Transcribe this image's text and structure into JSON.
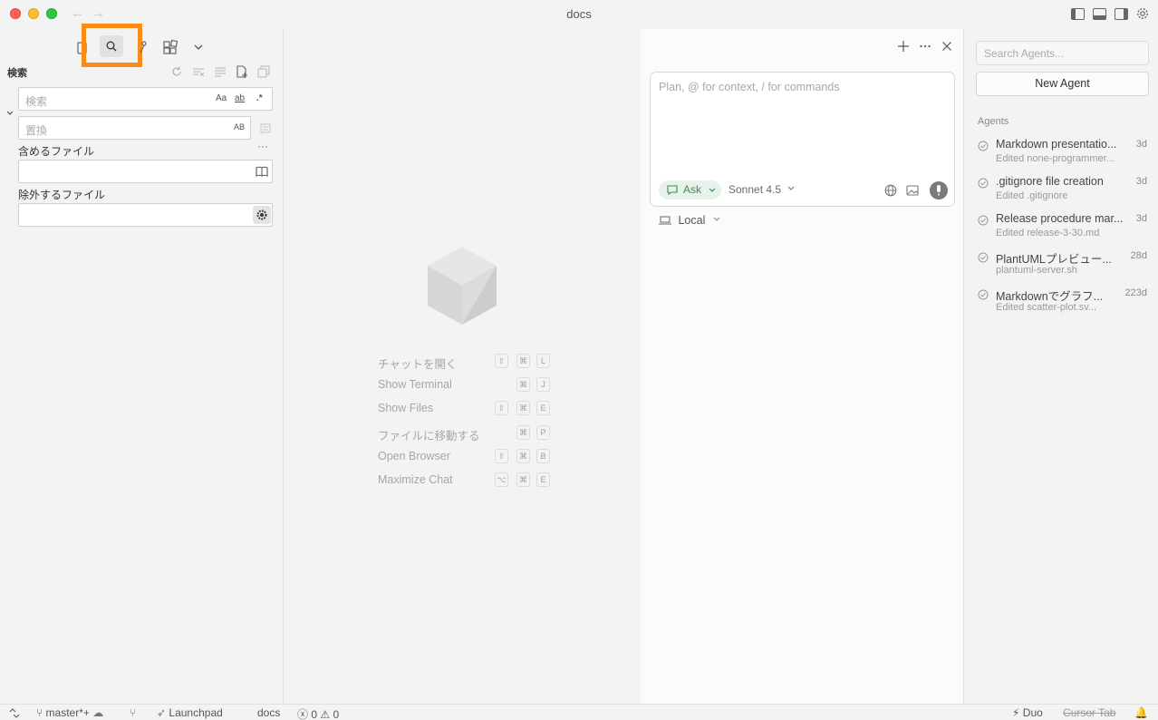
{
  "window": {
    "title": "docs"
  },
  "sidebar": {
    "section_title": "検索",
    "search": {
      "placeholder": "検索",
      "opt_case": "Aa",
      "opt_word": "ab",
      "opt_regex": ".*"
    },
    "replace": {
      "placeholder": "置換",
      "opt_preserve": "AB"
    },
    "include_label": "含めるファイル",
    "exclude_label": "除外するファイル",
    "more": "···"
  },
  "editor": {
    "shortcuts": [
      {
        "label": "チャットを開く",
        "keys": [
          "⇧",
          "⌘",
          "L"
        ]
      },
      {
        "label": "Show Terminal",
        "keys": [
          "⌘",
          "J"
        ]
      },
      {
        "label": "Show Files",
        "keys": [
          "⇧",
          "⌘",
          "E"
        ]
      },
      {
        "label": "ファイルに移動する",
        "keys": [
          "⌘",
          "P"
        ]
      },
      {
        "label": "Open Browser",
        "keys": [
          "⇧",
          "⌘",
          "B"
        ]
      },
      {
        "label": "Maximize Chat",
        "keys": [
          "⌥",
          "⌘",
          "E"
        ]
      }
    ]
  },
  "chat": {
    "placeholder": "Plan, @ for context, / for commands",
    "mode": "Ask",
    "model": "Sonnet 4.5",
    "environment": "Local"
  },
  "agents": {
    "search_placeholder": "Search Agents...",
    "new_agent": "New Agent",
    "header": "Agents",
    "items": [
      {
        "title": "Markdown presentatio...",
        "subtitle": "Edited none-programmer...",
        "age": "3d"
      },
      {
        "title": ".gitignore file creation",
        "subtitle": "Edited .gitignore",
        "age": "3d"
      },
      {
        "title": "Release procedure mar...",
        "subtitle": "Edited release-3-30.md",
        "age": "3d"
      },
      {
        "title": "PlantUMLプレビュー...",
        "subtitle": "plantuml-server.sh",
        "age": "28d"
      },
      {
        "title": "Markdownでグラフ...",
        "subtitle": "Edited scatter-plot.sv...",
        "age": "223d"
      }
    ]
  },
  "statusbar": {
    "branch": "master*+",
    "launchpad": "Launchpad",
    "folder": "docs",
    "errors": "0",
    "warnings": "0",
    "duo": "Duo",
    "cursor_tab": "Cursor Tab"
  },
  "colors": {
    "highlight": "#fb8c1a",
    "ask_green": "#3c8a5a"
  }
}
